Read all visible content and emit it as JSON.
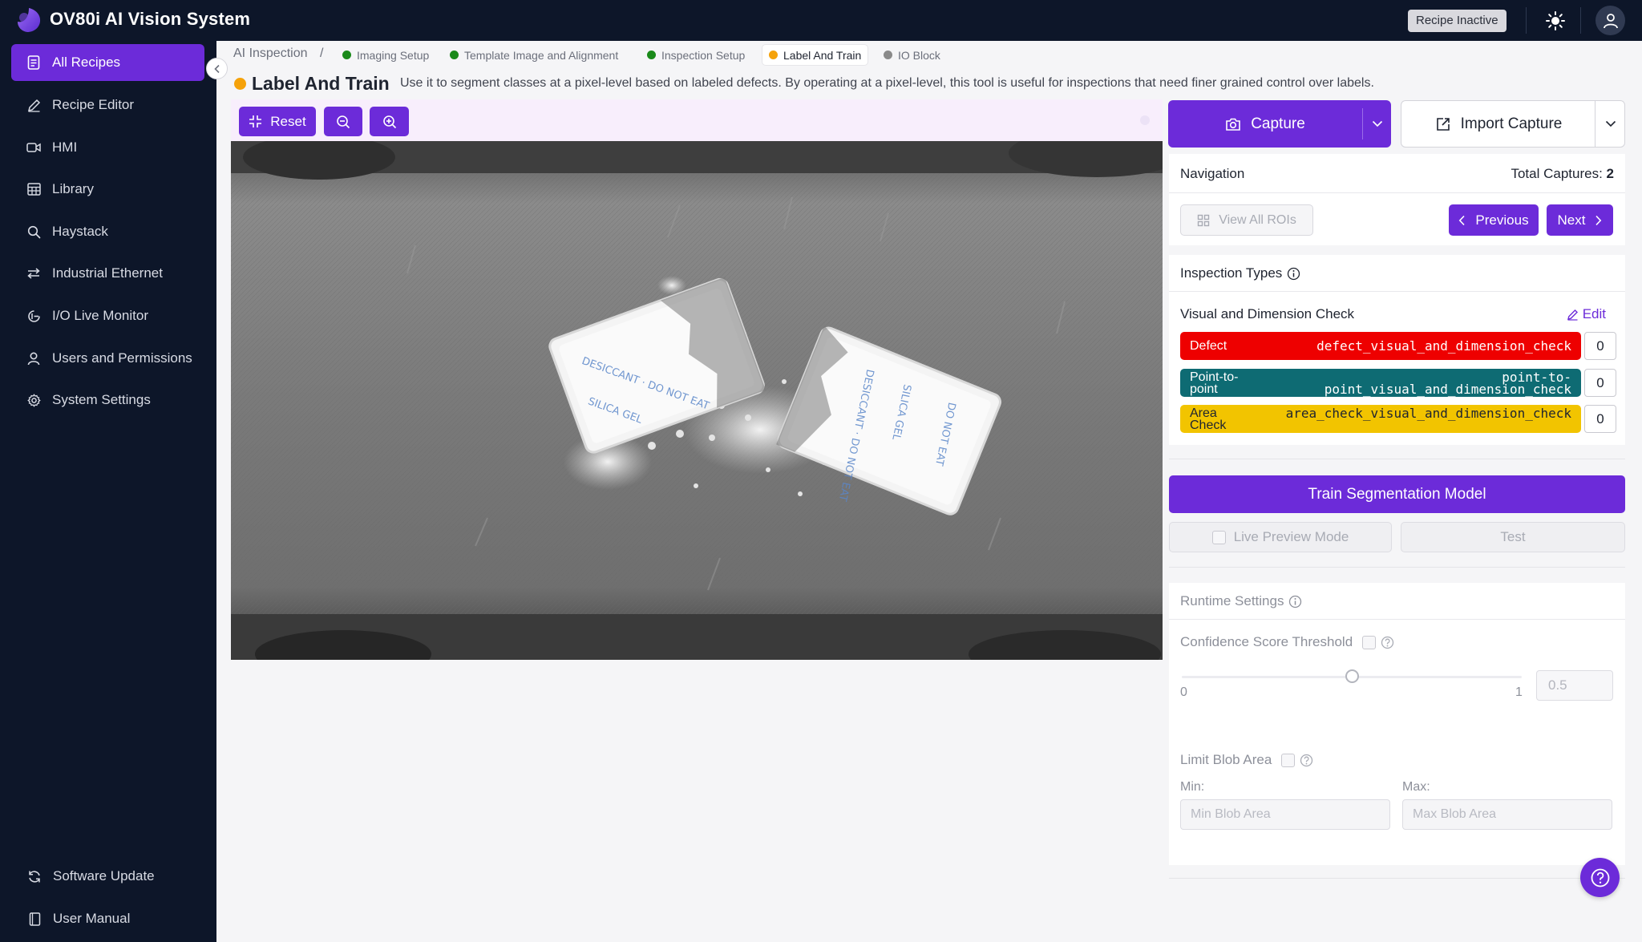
{
  "header": {
    "app_title": "OV80i AI Vision System",
    "recipe_status": "Recipe Inactive",
    "icons": {
      "logo": "ov80i-logo",
      "theme": "sun-icon",
      "user": "user-icon"
    }
  },
  "sidebar": {
    "items": [
      {
        "label": "All Recipes",
        "icon": "recipes-icon",
        "active": true
      },
      {
        "label": "Recipe Editor",
        "icon": "pencil-icon"
      },
      {
        "label": "HMI",
        "icon": "video-icon"
      },
      {
        "label": "Library",
        "icon": "grid-icon"
      },
      {
        "label": "Haystack",
        "icon": "search-icon"
      },
      {
        "label": "Industrial Ethernet",
        "icon": "transfer-icon"
      },
      {
        "label": "I/O Live Monitor",
        "icon": "monitor-icon"
      },
      {
        "label": "Users and Permissions",
        "icon": "user-icon"
      },
      {
        "label": "System Settings",
        "icon": "gear-icon"
      }
    ],
    "bottom": [
      {
        "label": "Software Update",
        "icon": "refresh-icon"
      },
      {
        "label": "User Manual",
        "icon": "book-icon"
      }
    ]
  },
  "breadcrumb": {
    "root": "AI Inspection",
    "separator": "/",
    "steps": [
      {
        "label": "Imaging Setup",
        "status_color": "#1a8a1a"
      },
      {
        "label": "Template Image and Alignment",
        "status_color": "#1a8a1a"
      },
      {
        "label": "Inspection Setup",
        "status_color": "#1a8a1a"
      },
      {
        "label": "Label And Train",
        "status_color": "#f5a20a",
        "active": true
      },
      {
        "label": "IO Block",
        "status_color": "#8a8a8a"
      }
    ]
  },
  "page": {
    "title": "Label And Train",
    "description": "Use it to segment classes at a pixel-level based on labeled defects. By operating at a pixel-level, this tool is useful for inspections that need finer grained control over labels.",
    "status_color": "#f5a20a"
  },
  "canvas_toolbar": {
    "reset_label": "Reset",
    "icons": {
      "reset": "fit-icon",
      "zoom_out": "zoom-out-icon",
      "zoom_in": "zoom-in-icon"
    }
  },
  "capture": {
    "capture_label": "Capture",
    "import_label": "Import Capture"
  },
  "navigation": {
    "title": "Navigation",
    "total_label": "Total Captures:",
    "total_value": "2",
    "view_all_label": "View All ROIs",
    "previous_label": "Previous",
    "next_label": "Next"
  },
  "inspection_types": {
    "title": "Inspection Types",
    "check_name": "Visual and Dimension Check",
    "edit_label": "Edit",
    "classes": [
      {
        "label": "Defect",
        "id": "defect_visual_and_dimension_check",
        "count": "0",
        "color": "#ee0000",
        "text_color": "#ffffff"
      },
      {
        "label": "Point-to-point",
        "id": "point-to-point_visual_and_dimension_check",
        "count": "0",
        "color": "#0e6b73",
        "text_color": "#ffffff"
      },
      {
        "label": "Area Check",
        "id": "area_check_visual_and_dimension_check",
        "count": "0",
        "color": "#f2c400",
        "text_color": "#1f2430"
      }
    ]
  },
  "training": {
    "train_label": "Train Segmentation Model",
    "live_preview_label": "Live Preview Mode",
    "test_label": "Test"
  },
  "runtime": {
    "title": "Runtime Settings",
    "confidence_label": "Confidence Score Threshold",
    "slider_min": "0",
    "slider_max": "1",
    "slider_value": "0.5",
    "limit_blob_label": "Limit Blob Area",
    "min_label": "Min:",
    "max_label": "Max:",
    "min_placeholder": "Min Blob Area",
    "max_placeholder": "Max Blob Area"
  }
}
